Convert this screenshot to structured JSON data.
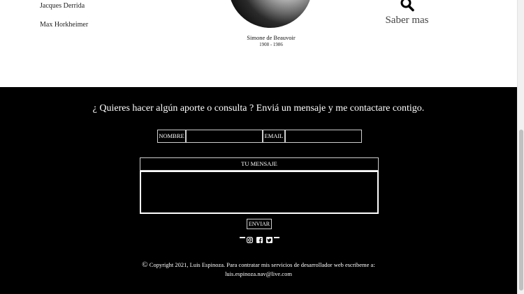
{
  "sidebar": {
    "links": [
      "Jacques Derrida",
      "Max Horkheimer"
    ]
  },
  "featured": {
    "name": "Simone de Beauvoir",
    "dates": "1908 - 1986"
  },
  "search": {
    "label": "Saber mas"
  },
  "contact": {
    "headline": "¿ Quieres hacer algún aporte o consulta ? Enviá un mensaje y me contactare contigo.",
    "name_label": "NOMBRE",
    "name_value": "",
    "email_label": "EMAIL",
    "email_value": "",
    "message_label": "TU MENSAJE",
    "message_value": "",
    "send_label": "ENVIAR"
  },
  "footer": {
    "socials": [
      "instagram-icon",
      "facebook-icon",
      "twitter-icon"
    ],
    "copyright_symbol": "©",
    "copyright_text": "Copyright 2021, Luis Espinoza. Para contratar mis servicios de desarrollador web escribeme a:",
    "email": "luis.espinoza.nav@live.com"
  },
  "colors": {
    "footer_bg": "#000000",
    "page_bg": "#ffffff",
    "text_light": "#ffffff"
  }
}
